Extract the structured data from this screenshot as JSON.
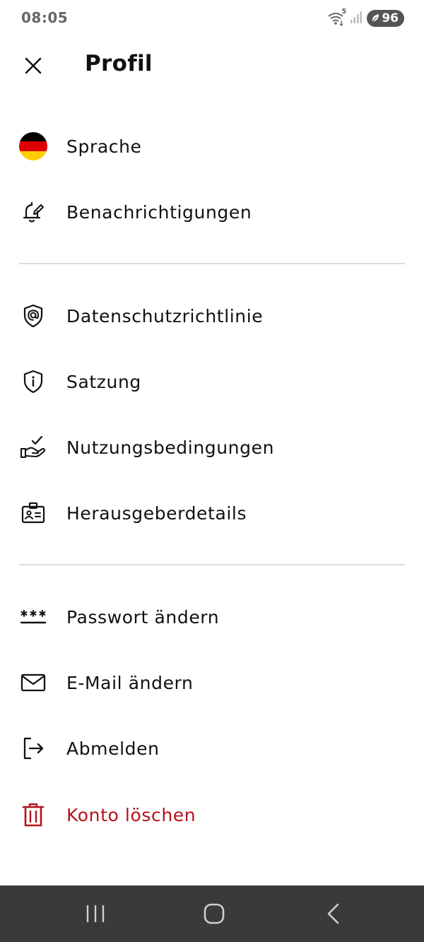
{
  "status_bar": {
    "time": "08:05",
    "wifi_label": "5",
    "battery_level": "96",
    "icons": [
      "wifi-icon",
      "signal-icon",
      "battery-icon"
    ]
  },
  "header": {
    "title": "Profil",
    "close_icon": "close-icon"
  },
  "menu": {
    "group1": [
      {
        "label": "Sprache",
        "icon": "german-flag-icon"
      },
      {
        "label": "Benachrichtigungen",
        "icon": "bell-edit-icon"
      }
    ],
    "group2": [
      {
        "label": "Datenschutzrichtlinie",
        "icon": "shield-at-icon"
      },
      {
        "label": "Satzung",
        "icon": "shield-info-icon"
      },
      {
        "label": "Nutzungsbedingungen",
        "icon": "hand-check-icon"
      },
      {
        "label": "Herausgeberdetails",
        "icon": "id-badge-icon"
      }
    ],
    "group3": [
      {
        "label": "Passwort ändern",
        "icon": "password-icon"
      },
      {
        "label": "E-Mail ändern",
        "icon": "mail-icon"
      },
      {
        "label": "Abmelden",
        "icon": "logout-icon"
      },
      {
        "label": "Konto löschen",
        "icon": "trash-icon"
      }
    ]
  },
  "colors": {
    "text": "#111111",
    "danger": "#b3131b",
    "divider": "#dddddd",
    "nav_bar": "#3a3a3a",
    "flag_black": "#000000",
    "flag_red": "#dd0000",
    "flag_gold": "#ffce00"
  },
  "nav_bar": {
    "icons": [
      "recent-apps-icon",
      "home-icon",
      "back-icon"
    ]
  }
}
